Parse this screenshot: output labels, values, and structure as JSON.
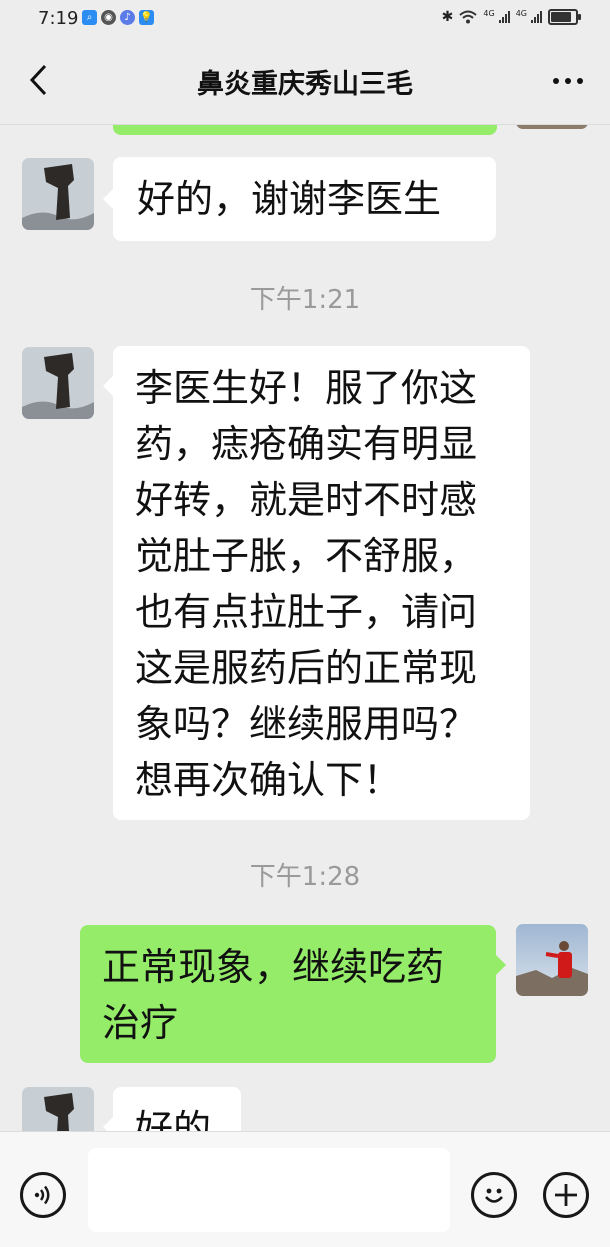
{
  "status_bar": {
    "time": "7:19",
    "network_left": "4G",
    "network_right": "4G",
    "battery_level": 0.9
  },
  "header": {
    "title": "鼻炎重庆秀山三毛"
  },
  "messages": [
    {
      "type": "text",
      "side": "in",
      "text": "好的，谢谢李医生"
    },
    {
      "type": "time",
      "text": "下午1:21"
    },
    {
      "type": "text",
      "side": "in",
      "lines": [
        "李医生好！服了你这",
        "药，痣疮确实有明显",
        "好转，就是时不时感",
        "觉肚子胀，不舒服，",
        "也有点拉肚子，请问",
        "这是服药后的正常现",
        "象吗？继续服用吗？",
        "想再次确认下！"
      ]
    },
    {
      "type": "time",
      "text": "下午1:28"
    },
    {
      "type": "text",
      "side": "out",
      "lines": [
        "正常现象，继续吃药",
        "治疗"
      ]
    },
    {
      "type": "text",
      "side": "in",
      "text": "好的"
    }
  ],
  "input": {
    "value": ""
  },
  "colors": {
    "background": "#ededed",
    "bubble_out": "#95ec69",
    "bubble_in": "#ffffff",
    "timestamp": "#9a9a9a"
  },
  "icons": {
    "back": "chevron-left-icon",
    "more": "more-dots-icon",
    "voice": "voice-icon",
    "emoji": "emoji-icon",
    "add": "plus-icon"
  }
}
